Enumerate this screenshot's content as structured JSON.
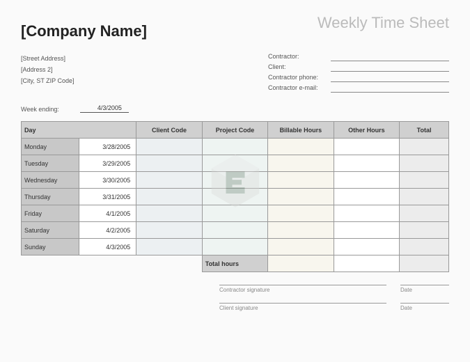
{
  "header": {
    "company": "[Company Name]",
    "title": "Weekly Time Sheet"
  },
  "address": {
    "line1": "[Street Address]",
    "line2": "[Address 2]",
    "line3": "[City, ST ZIP Code]"
  },
  "contractor": {
    "labels": {
      "contractor": "Contractor:",
      "client": "Client:",
      "phone": "Contractor phone:",
      "email": "Contractor e-mail:"
    }
  },
  "week_ending": {
    "label": "Week ending:",
    "value": "4/3/2005"
  },
  "columns": {
    "day": "Day",
    "client_code": "Client Code",
    "project_code": "Project Code",
    "billable": "Billable Hours",
    "other": "Other Hours",
    "total": "Total"
  },
  "rows": [
    {
      "day": "Monday",
      "date": "3/28/2005"
    },
    {
      "day": "Tuesday",
      "date": "3/29/2005"
    },
    {
      "day": "Wednesday",
      "date": "3/30/2005"
    },
    {
      "day": "Thursday",
      "date": "3/31/2005"
    },
    {
      "day": "Friday",
      "date": "4/1/2005"
    },
    {
      "day": "Saturday",
      "date": "4/2/2005"
    },
    {
      "day": "Sunday",
      "date": "4/3/2005"
    }
  ],
  "total_row": {
    "label": "Total hours"
  },
  "signatures": {
    "contractor": "Contractor signature",
    "client": "Client signature",
    "date": "Date"
  }
}
